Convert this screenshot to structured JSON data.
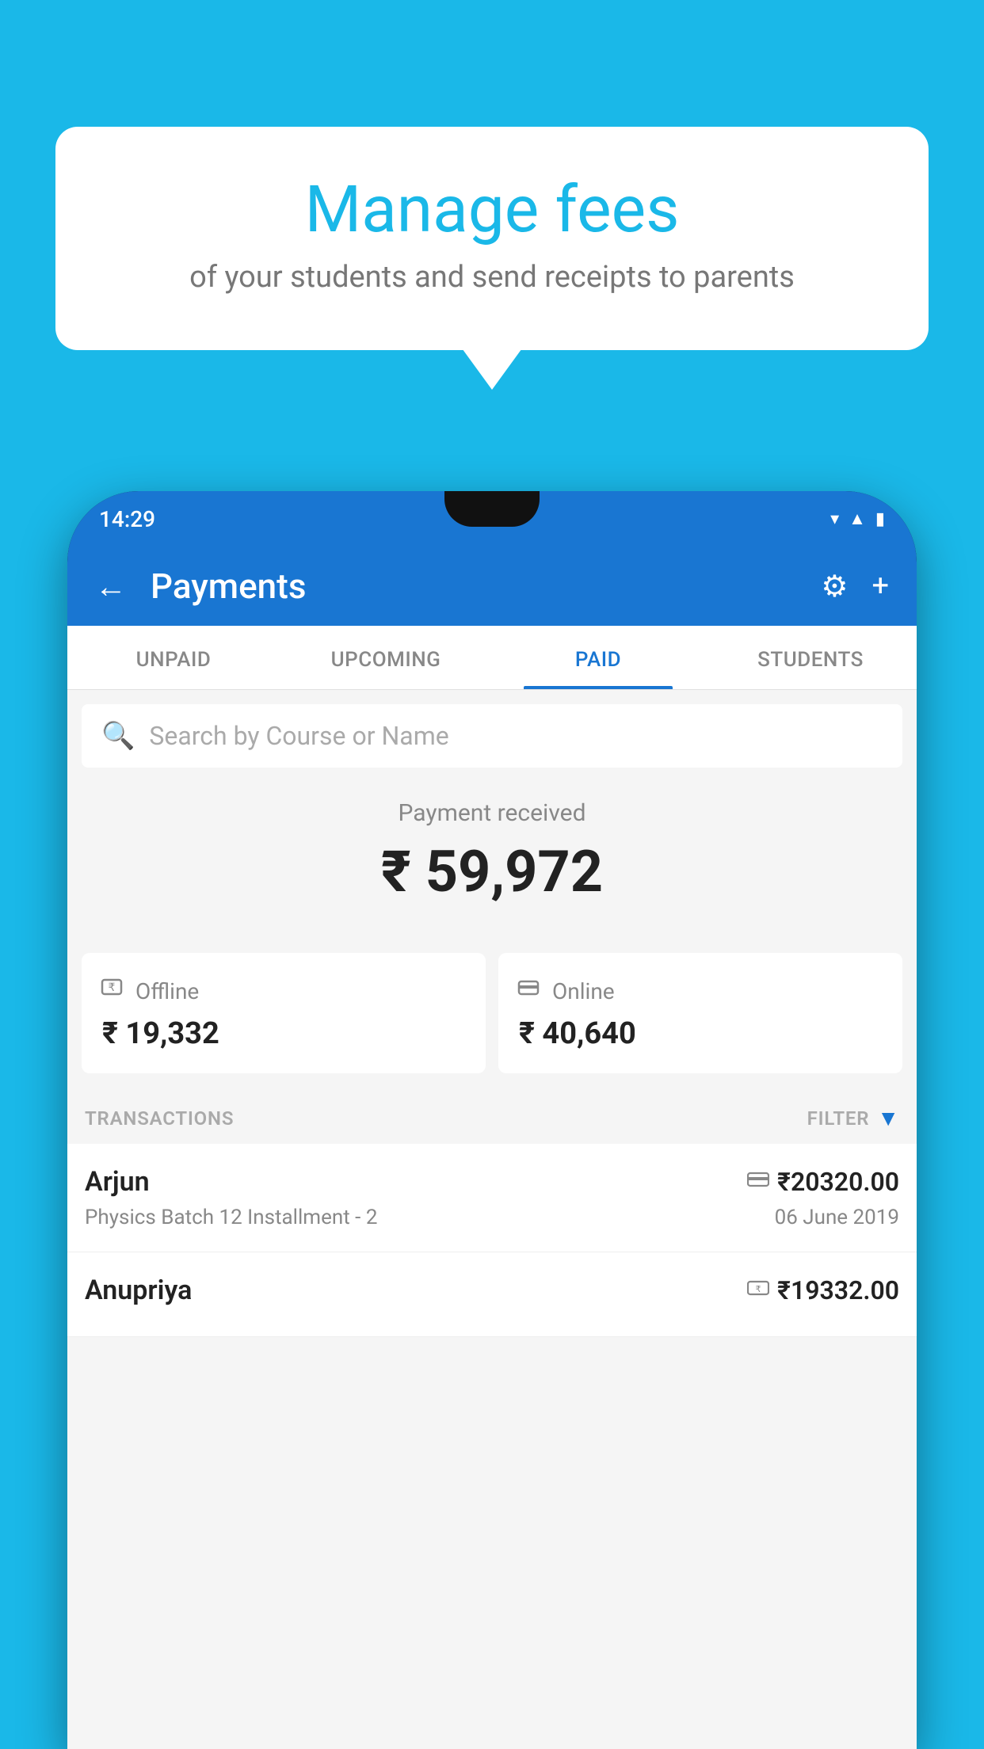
{
  "background_color": "#1ab8e8",
  "speech_bubble": {
    "title": "Manage fees",
    "subtitle": "of your students and send receipts to parents"
  },
  "phone": {
    "status_bar": {
      "time": "14:29"
    },
    "app_bar": {
      "title": "Payments",
      "back_icon": "←",
      "settings_icon": "⚙",
      "add_icon": "+"
    },
    "tabs": [
      {
        "label": "UNPAID",
        "active": false
      },
      {
        "label": "UPCOMING",
        "active": false
      },
      {
        "label": "PAID",
        "active": true
      },
      {
        "label": "STUDENTS",
        "active": false
      }
    ],
    "search": {
      "placeholder": "Search by Course or Name"
    },
    "payment_summary": {
      "label": "Payment received",
      "total": "₹ 59,972",
      "offline": {
        "icon": "💳",
        "label": "Offline",
        "amount": "₹ 19,332"
      },
      "online": {
        "icon": "💳",
        "label": "Online",
        "amount": "₹ 40,640"
      }
    },
    "transactions": {
      "header_label": "TRANSACTIONS",
      "filter_label": "FILTER",
      "items": [
        {
          "name": "Arjun",
          "amount": "₹20320.00",
          "course": "Physics Batch 12 Installment - 2",
          "date": "06 June 2019",
          "payment_type": "online"
        },
        {
          "name": "Anupriya",
          "amount": "₹19332.00",
          "course": "",
          "date": "",
          "payment_type": "offline"
        }
      ]
    }
  }
}
